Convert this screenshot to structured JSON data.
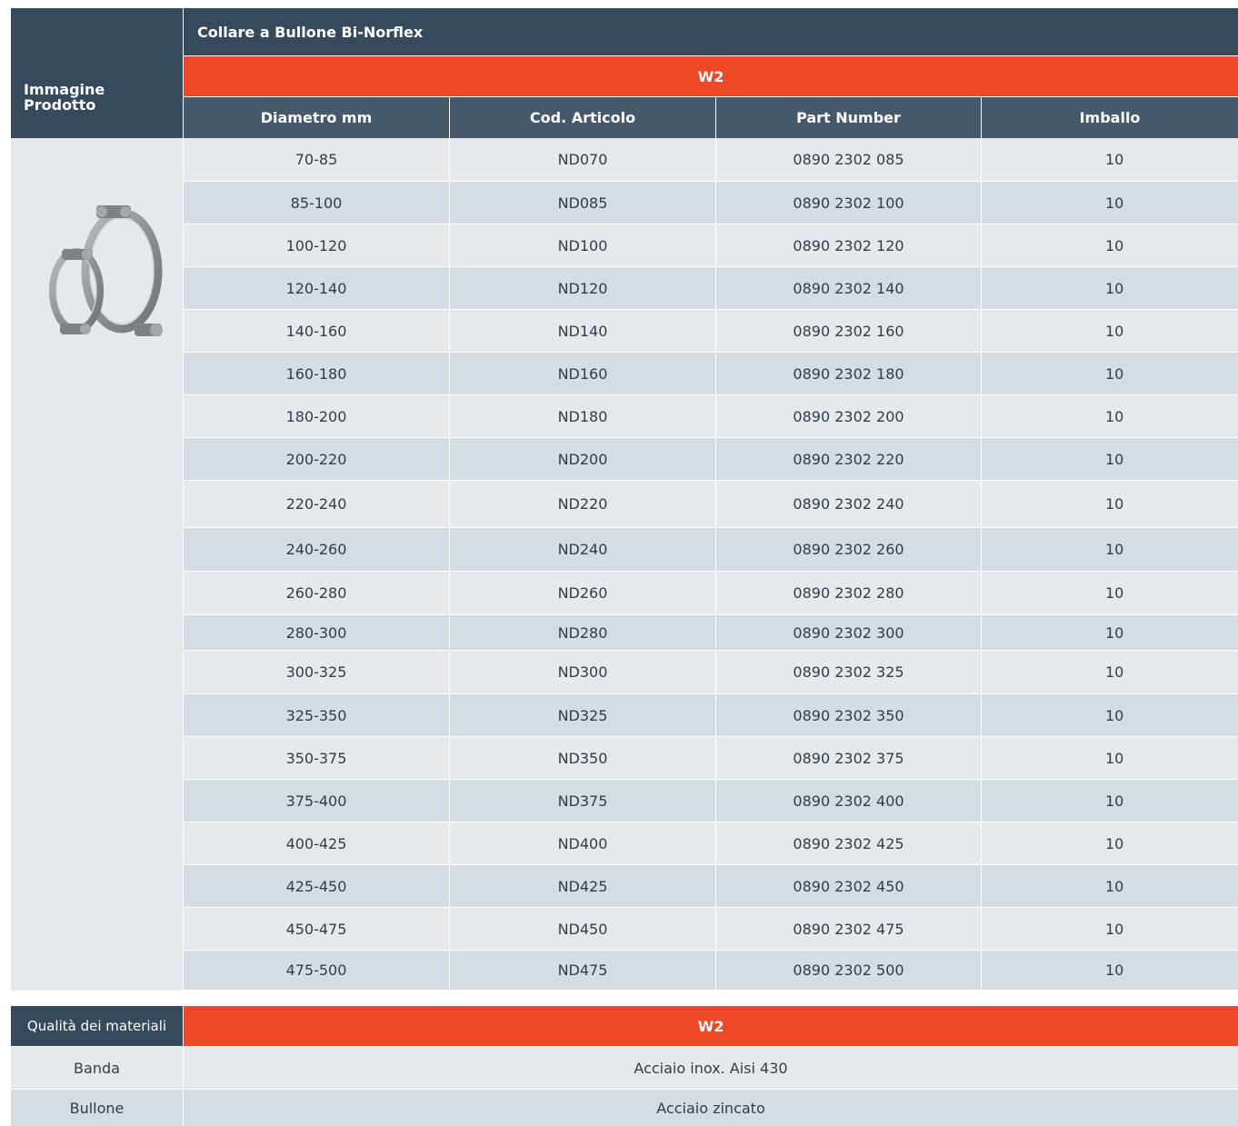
{
  "main_table": {
    "image_column_header": "Immagine\nProdotto",
    "product_title": "Collare a Bullone Bi-Norflex",
    "material_band": "W2",
    "columns": [
      "Diametro mm",
      "Cod. Articolo",
      "Part Number",
      "Imballo"
    ],
    "rows": [
      [
        "70-85",
        "ND070",
        "0890 2302 085",
        "10"
      ],
      [
        "85-100",
        "ND085",
        "0890 2302 100",
        "10"
      ],
      [
        "100-120",
        "ND100",
        "0890 2302 120",
        "10"
      ],
      [
        "120-140",
        "ND120",
        "0890 2302 140",
        "10"
      ],
      [
        "140-160",
        "ND140",
        "0890 2302 160",
        "10"
      ],
      [
        "160-180",
        "ND160",
        "0890 2302 180",
        "10"
      ],
      [
        "180-200",
        "ND180",
        "0890 2302 200",
        "10"
      ],
      [
        "200-220",
        "ND200",
        "0890 2302 220",
        "10"
      ],
      [
        "220-240",
        "ND220",
        "0890 2302 240",
        "10"
      ],
      [
        "240-260",
        "ND240",
        "0890 2302 260",
        "10"
      ],
      [
        "260-280",
        "ND260",
        "0890 2302 280",
        "10"
      ],
      [
        "280-300",
        "ND280",
        "0890 2302 300",
        "10"
      ],
      [
        "300-325",
        "ND300",
        "0890 2302 325",
        "10"
      ],
      [
        "325-350",
        "ND325",
        "0890 2302 350",
        "10"
      ],
      [
        "350-375",
        "ND350",
        "0890 2302 375",
        "10"
      ],
      [
        "375-400",
        "ND375",
        "0890 2302 400",
        "10"
      ],
      [
        "400-425",
        "ND400",
        "0890 2302 425",
        "10"
      ],
      [
        "425-450",
        "ND425",
        "0890 2302 450",
        "10"
      ],
      [
        "450-475",
        "ND450",
        "0890 2302 475",
        "10"
      ],
      [
        "475-500",
        "ND475",
        "0890 2302 500",
        "10"
      ]
    ]
  },
  "materials_table": {
    "header_label": "Qualità dei materiali",
    "header_value": "W2",
    "rows": [
      {
        "label": "Banda",
        "value": "Acciaio inox. Aisi 430"
      },
      {
        "label": "Bullone",
        "value": "Acciaio zincato"
      }
    ]
  },
  "colors": {
    "header_dark": "#364a5c",
    "header_mid": "#45596b",
    "accent_orange": "#ee4827",
    "row_light": "#e6e9ec",
    "row_alt": "#d5dce3"
  },
  "icons": {
    "product_image": "bolt-clamp-image"
  }
}
